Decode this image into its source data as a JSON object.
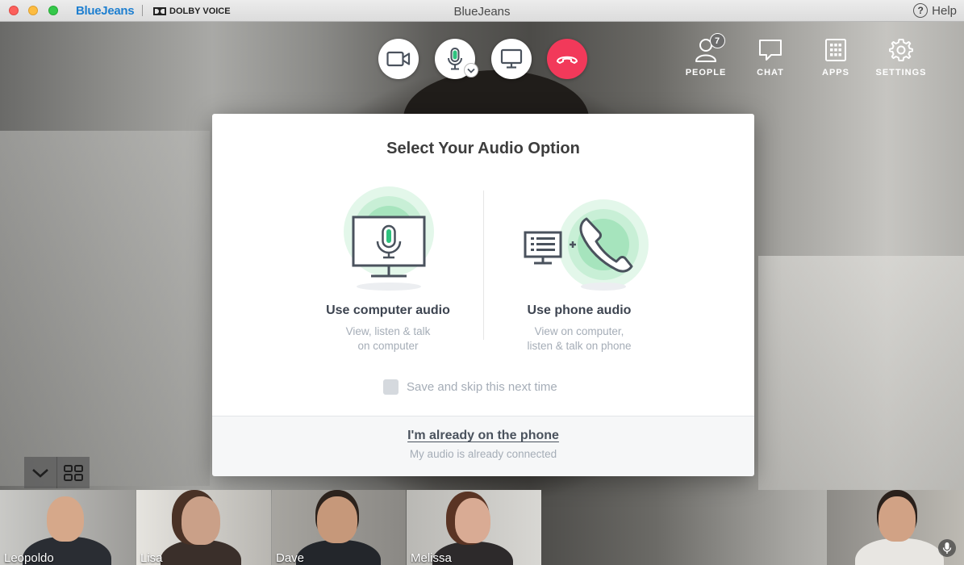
{
  "titlebar": {
    "brand": "BlueJeans",
    "partner": "DOLBY VOICE",
    "window_title": "BlueJeans",
    "help_label": "Help"
  },
  "toolbar": {
    "buttons": [
      {
        "name": "video-toggle",
        "icon": "video-camera-icon"
      },
      {
        "name": "mic-toggle",
        "icon": "microphone-icon",
        "menu_icon": "chevron-down-icon"
      },
      {
        "name": "share-screen",
        "icon": "monitor-icon"
      },
      {
        "name": "end-call",
        "icon": "hang-up-icon",
        "color": "#f2395a"
      }
    ],
    "tools": {
      "people": {
        "label": "PEOPLE",
        "badge": "7",
        "icon": "person-icon"
      },
      "chat": {
        "label": "CHAT",
        "icon": "chat-bubble-icon"
      },
      "apps": {
        "label": "APPS",
        "icon": "grid-icon"
      },
      "settings": {
        "label": "SETTINGS",
        "icon": "gear-icon"
      }
    }
  },
  "modal": {
    "title": "Select Your Audio Option",
    "computer_option": {
      "title": "Use computer audio",
      "subtitle_line1": "View, listen & talk",
      "subtitle_line2": "on computer",
      "icon": "monitor-microphone-icon"
    },
    "phone_option": {
      "title": "Use phone audio",
      "subtitle_line1": "View on computer,",
      "subtitle_line2": "listen & talk on phone",
      "icon": "screen-plus-phone-icon"
    },
    "save_label": "Save and skip this next time",
    "save_checked": false,
    "footer_link": "I'm already on the phone",
    "footer_sub": "My audio is already connected",
    "accent_green": "#7ed6a0"
  },
  "strip": {
    "collapse_icon": "chevron-down-icon",
    "layout_icon": "grid-layout-icon",
    "participants": [
      {
        "name": "Leopoldo"
      },
      {
        "name": "Lisa"
      },
      {
        "name": "Dave"
      },
      {
        "name": "Melissa"
      }
    ],
    "self_view_mic_icon": "microphone-icon"
  }
}
